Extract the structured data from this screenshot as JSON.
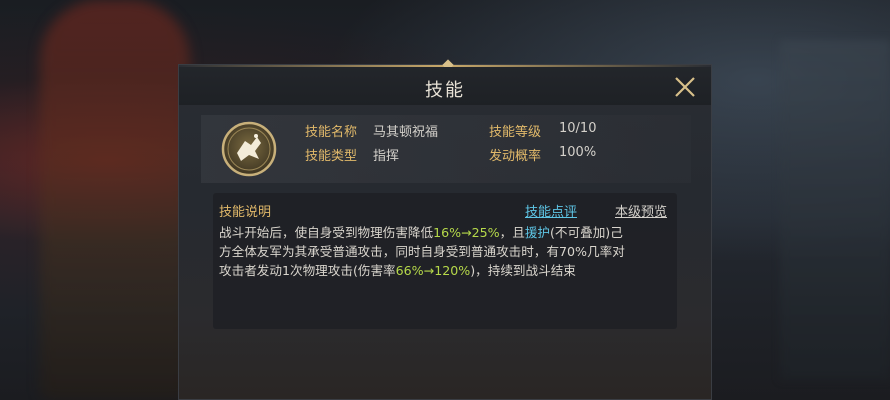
{
  "dialog": {
    "title": "技能",
    "close_icon": "close-icon"
  },
  "skill": {
    "icon": "skill-emblem-icon",
    "name_label": "技能名称",
    "name_value": "马其顿祝福",
    "level_label": "技能等级",
    "level_value": "10/10",
    "type_label": "技能类型",
    "type_value": "指挥",
    "chance_label": "发动概率",
    "chance_value": "100%"
  },
  "description": {
    "title": "技能说明",
    "review_link": "技能点评",
    "preview_link": "本级预览",
    "line1_a": "战斗开始后，使自身受到物理伤害降低",
    "line1_hl": "16%→25%",
    "line1_b": "，且",
    "line1_kw": "援护",
    "line1_c": "(不可叠加)己",
    "line2": "方全体友军为其承受普通攻击，同时自身受到普通攻击时，有70%几率对",
    "line3_a": "攻击者发动1次物理攻击(伤害率",
    "line3_hl": "66%→120%",
    "line3_b": ")，持续到战斗结束"
  },
  "colors": {
    "label_gold": "#e1b96a",
    "highlight_green": "#b6d94a",
    "link_cyan": "#5ec6e6"
  }
}
